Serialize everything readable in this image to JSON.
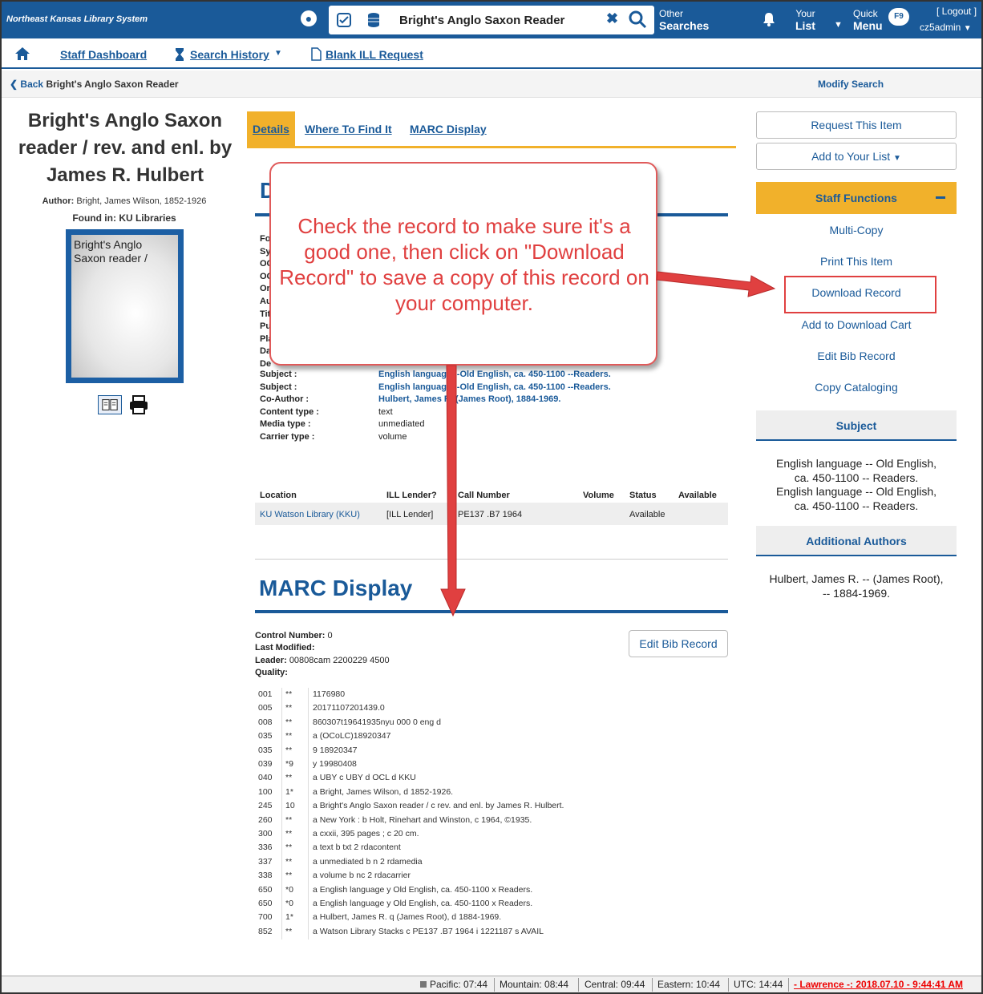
{
  "topbar": {
    "brand": "Northeast Kansas Library System",
    "search_value": "Bright's Anglo Saxon Reader",
    "other_label": "Other",
    "searches_label": "Searches",
    "your_label": "Your",
    "list_label": "List",
    "quick_label": "Quick",
    "menu_label": "Menu",
    "f9_label": "F9",
    "logout_label": "[ Logout ]",
    "user": "cz5admin"
  },
  "nav": {
    "dashboard": "Staff Dashboard",
    "history": "Search History",
    "ill": "Blank ILL Request"
  },
  "backrow": {
    "back_label": "Back",
    "back_title": "Bright's Anglo Saxon Reader",
    "modify": "Modify Search"
  },
  "record": {
    "title_lines": [
      "Bright's Anglo Saxon",
      "reader / rev. and enl. by",
      "James R. Hulbert"
    ],
    "author_label": "Author:",
    "author": "Bright, James Wilson, 1852-1926",
    "found_label": "Found in:",
    "found": "KU Libraries",
    "cover_lines": [
      "Bright's Anglo",
      "Saxon reader /"
    ]
  },
  "tabs": [
    "Details",
    "Where To Find It",
    "MARC Display"
  ],
  "details": {
    "heading_letter": "D",
    "hidden_labels": [
      "Fo",
      "Sy",
      "OC",
      "OC",
      "Or",
      "Au",
      "Tit",
      "Pu",
      "Pla",
      "Da",
      "De"
    ],
    "fields": [
      {
        "label": "Subject :",
        "value": "English language --Old English, ca. 450-1100 --Readers.",
        "link": true
      },
      {
        "label": "Subject :",
        "value": "English language --Old English, ca. 450-1100 --Readers.",
        "link": true
      },
      {
        "label": "Co-Author :",
        "value": "Hulbert, James R. (James Root), 1884-1969.",
        "link": true
      },
      {
        "label": "Content type :",
        "value": "text",
        "link": false
      },
      {
        "label": "Media type :",
        "value": "unmediated",
        "link": false
      },
      {
        "label": "Carrier type :",
        "value": "volume",
        "link": false
      }
    ]
  },
  "holdings": {
    "headers": [
      "Location",
      "ILL Lender?",
      "Call Number",
      "Volume",
      "Status",
      "Available"
    ],
    "row": [
      "KU Watson Library (KKU)",
      "[ILL Lender]",
      "PE137 .B7 1964",
      "",
      "Available",
      ""
    ]
  },
  "marc": {
    "heading": "MARC Display",
    "control_label": "Control Number:",
    "control": "0",
    "modified_label": "Last Modified:",
    "modified": "",
    "leader_label": "Leader:",
    "leader": "00808cam 2200229 4500",
    "quality_label": "Quality:",
    "quality": "",
    "edit_button": "Edit Bib Record",
    "rows": [
      {
        "tag": "001",
        "ind": "**",
        "val": "1176980"
      },
      {
        "tag": "005",
        "ind": "**",
        "val": "20171107201439.0"
      },
      {
        "tag": "008",
        "ind": "**",
        "val": "860307t19641935nyu 000 0 eng d"
      },
      {
        "tag": "035",
        "ind": "**",
        "val": "a (OCoLC)18920347"
      },
      {
        "tag": "035",
        "ind": "**",
        "val": "9 18920347"
      },
      {
        "tag": "039",
        "ind": "*9",
        "val": "y 19980408"
      },
      {
        "tag": "040",
        "ind": "**",
        "val": "a UBY c UBY d OCL d KKU"
      },
      {
        "tag": "100",
        "ind": "1*",
        "val": "a Bright, James Wilson, d 1852-1926."
      },
      {
        "tag": "245",
        "ind": "10",
        "val": "a Bright's Anglo Saxon reader / c rev. and enl. by James R. Hulbert."
      },
      {
        "tag": "260",
        "ind": "**",
        "val": "a New York : b Holt, Rinehart and Winston, c 1964, ©1935."
      },
      {
        "tag": "300",
        "ind": "**",
        "val": "a cxxii, 395 pages ; c 20 cm."
      },
      {
        "tag": "336",
        "ind": "**",
        "val": "a text b txt 2 rdacontent"
      },
      {
        "tag": "337",
        "ind": "**",
        "val": "a unmediated b n 2 rdamedia"
      },
      {
        "tag": "338",
        "ind": "**",
        "val": "a volume b nc 2 rdacarrier"
      },
      {
        "tag": "650",
        "ind": "*0",
        "val": "a English language y Old English, ca. 450-1100 x Readers."
      },
      {
        "tag": "650",
        "ind": "*0",
        "val": "a English language y Old English, ca. 450-1100 x Readers."
      },
      {
        "tag": "700",
        "ind": "1*",
        "val": "a Hulbert, James R. q (James Root), d 1884-1969."
      },
      {
        "tag": "852",
        "ind": "**",
        "val": "a Watson Library Stacks c PE137 .B7 1964 i 1221187 s AVAIL"
      }
    ]
  },
  "sidebar": {
    "request": "Request This Item",
    "add_list": "Add to Your List",
    "staff_functions": "Staff Functions",
    "links": [
      "Multi-Copy",
      "Print This Item",
      "Download Record",
      "Add to Download Cart",
      "Edit Bib Record",
      "Copy Cataloging"
    ],
    "subject_head": "Subject",
    "subject_lines": [
      "English language -- Old English,",
      "ca. 450-1100 -- Readers.",
      "English language -- Old English,",
      "ca. 450-1100 -- Readers."
    ],
    "authors_head": "Additional Authors",
    "author_lines": [
      "Hulbert, James R. -- (James Root),",
      "-- 1884-1969."
    ]
  },
  "callout": {
    "text": "Check the record to make sure it's a good one, then click on \"Download Record\" to save a copy of this record on your computer."
  },
  "statusbar": {
    "pacific": "Pacific: 07:44",
    "mountain": "Mountain: 08:44",
    "central": "Central: 09:44",
    "eastern": "Eastern: 10:44",
    "utc": "UTC: 14:44",
    "session": "- Lawrence -: 2018.07.10 - 9:44:41 AM"
  },
  "colors": {
    "brand": "#1a5a99",
    "accent": "#f1b12b",
    "callout": "#e04040"
  },
  "icons": [
    "globe-icon",
    "checklist-icon",
    "database-icon",
    "clear-icon",
    "search-icon",
    "bell-icon",
    "home-icon",
    "hourglass-icon",
    "document-icon",
    "back-icon",
    "book-view-icon",
    "print-icon",
    "minus-icon"
  ]
}
